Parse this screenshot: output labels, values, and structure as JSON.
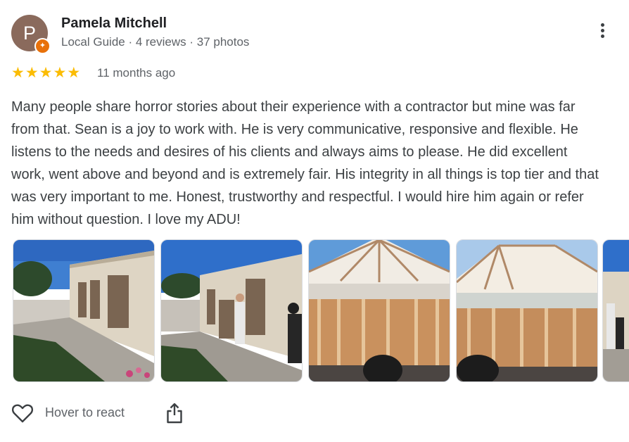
{
  "reviewer": {
    "initial": "P",
    "name": "Pamela Mitchell",
    "meta": "Local Guide · 4 reviews · 37 photos",
    "badge_icon": "local-guide-star-icon"
  },
  "rating": {
    "stars": 5,
    "max": 5,
    "time": "11 months ago"
  },
  "review_text": "Many people share horror stories about their experience with a contractor but mine was far from that. Sean is a joy to work with. He is very communicative, responsive and flexible. He listens to the needs and desires of his clients and always aims to please. He did excellent work, went above and beyond and is extremely fair. His integrity in all things is top tier and that was very important to me. Honest, trustworthy and respectful. I would hire him again or refer him without question. I love my ADU!",
  "photos": [
    {
      "subject": "wall-with-decorative-panels"
    },
    {
      "subject": "workers-installing-panels"
    },
    {
      "subject": "adu-roof-framing"
    },
    {
      "subject": "adu-roof-framing-wide"
    },
    {
      "subject": "partial-photo"
    }
  ],
  "actions": {
    "react_label": "Hover to react",
    "heart_icon": "heart-outline-icon",
    "share_icon": "share-icon"
  },
  "colors": {
    "star": "#fbbc04",
    "avatar": "#8a6a5c",
    "badge": "#e8710a",
    "secondary_text": "#5f6368"
  }
}
